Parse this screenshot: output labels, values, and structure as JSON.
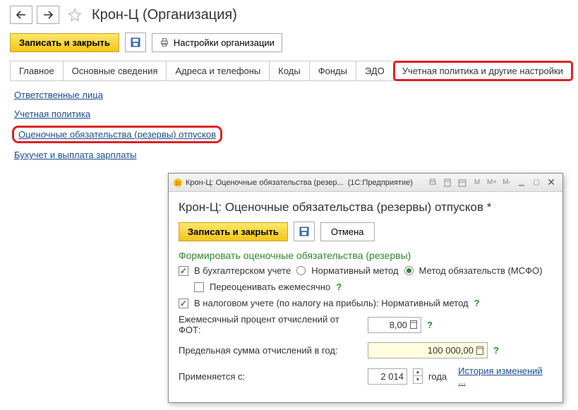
{
  "page": {
    "title": "Крон-Ц (Организация)"
  },
  "toolbar": {
    "save_close": "Записать и закрыть",
    "settings": "Настройки организации"
  },
  "tabs": {
    "main": "Главное",
    "basic": "Основные сведения",
    "addresses": "Адреса и телефоны",
    "codes": "Коды",
    "funds": "Фонды",
    "edo": "ЭДО",
    "accounting_policy": "Учетная политика и другие настройки"
  },
  "links": {
    "responsible": "Ответственные лица",
    "policy": "Учетная политика",
    "vacation_reserves": "Оценочные обязательства (резервы) отпусков",
    "payroll": "Бухучет и выплата зарплаты"
  },
  "dialog": {
    "titlebar": {
      "title": "Крон-Ц: Оценочные обязательства (резер...",
      "app": "(1С:Предприятие)",
      "m": "M",
      "m_plus": "M+",
      "m_minus": "M-"
    },
    "heading": "Крон-Ц: Оценочные обязательства (резервы) отпусков *",
    "buttons": {
      "save_close": "Записать и закрыть",
      "cancel": "Отмена"
    },
    "section": "Формировать оценочные обязательства (резервы)",
    "checkboxes": {
      "accounting": "В бухгалтерском учете",
      "revalue_monthly": "Переоценивать ежемесячно",
      "tax": "В налоговом учете (по налогу на прибыль): Нормативный метод"
    },
    "radios": {
      "normative": "Нормативный метод",
      "msfo": "Метод обязательств (МСФО)"
    },
    "fields": {
      "monthly_percent_label": "Ежемесячный процент отчислений от ФОТ:",
      "monthly_percent_value": "8,00",
      "annual_limit_label": "Предельная сумма отчислений в год:",
      "annual_limit_value": "100 000,00",
      "applies_from_label": "Применяется с:",
      "year_value": "2 014",
      "year_suffix": "года",
      "history_link": "История изменений ..."
    }
  }
}
